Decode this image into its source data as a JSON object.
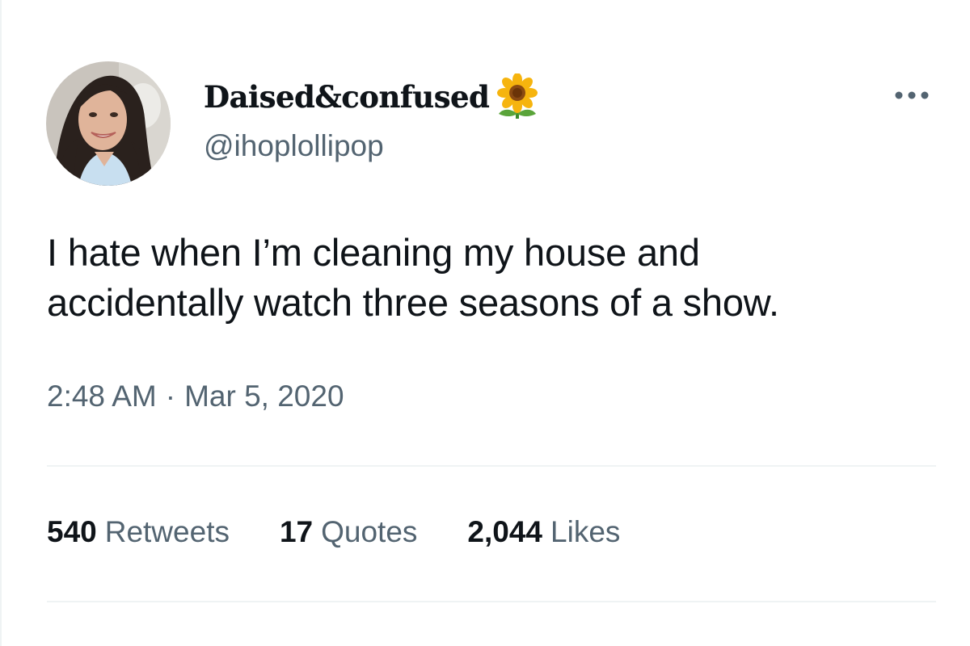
{
  "author": {
    "display_name": "Daised&confused",
    "name_emoji": "sunflower-icon",
    "handle": "@ihoplollipop"
  },
  "tweet": {
    "text_line1": "I hate when I’m cleaning my house and",
    "text_line2": "accidentally watch three seasons of a show.",
    "time": "2:48 AM",
    "separator": "·",
    "date": "Mar 5, 2020"
  },
  "stats": {
    "retweets_count": "540",
    "retweets_label": "Retweets",
    "quotes_count": "17",
    "quotes_label": "Quotes",
    "likes_count": "2,044",
    "likes_label": "Likes"
  },
  "colors": {
    "text_primary": "#0f1419",
    "text_secondary": "#536471",
    "divider": "#eff3f4"
  }
}
